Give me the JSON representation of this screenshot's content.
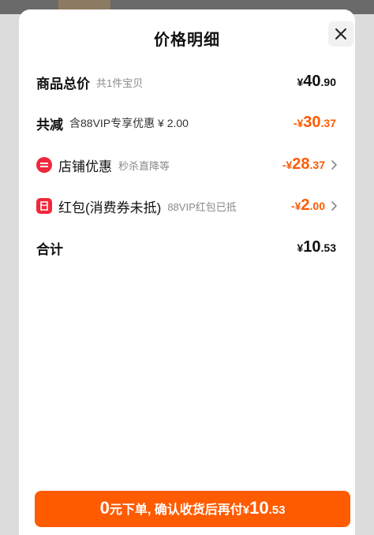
{
  "header": {
    "title": "价格明细",
    "close_icon": "close-icon"
  },
  "rows": {
    "goods_total": {
      "label": "商品总价",
      "sub": "共1件宝贝",
      "amount": {
        "sym": "¥",
        "int": "40",
        "dec": ".90"
      }
    },
    "total_discount": {
      "label": "共减",
      "sub": "含88VIP专享优惠 ¥ 2.00",
      "amount": {
        "sym": "-¥",
        "int": "30",
        "dec": ".37"
      }
    },
    "store_discount": {
      "icon": "minus-circle-icon",
      "label": "店铺优惠",
      "sub": "秒杀直降等",
      "amount": {
        "sym": "-¥",
        "int": "28",
        "dec": ".37"
      }
    },
    "red_packet": {
      "icon": "red-packet-icon",
      "label": "红包(消费券未抵)",
      "sub": "88VIP红包已抵",
      "amount": {
        "sym": "-¥",
        "int": "2",
        "dec": ".00"
      }
    },
    "sum": {
      "label": "合计",
      "amount": {
        "sym": "¥",
        "int": "10",
        "dec": ".53"
      }
    }
  },
  "cta": {
    "zero": "0",
    "text": "元下单, 确认收货后再付",
    "sym": "¥",
    "int": "10",
    "dec": ".53"
  },
  "colors": {
    "accent": "#ff5b00",
    "discount_text": "#ff5a00",
    "icon_red": "#f0283c"
  }
}
